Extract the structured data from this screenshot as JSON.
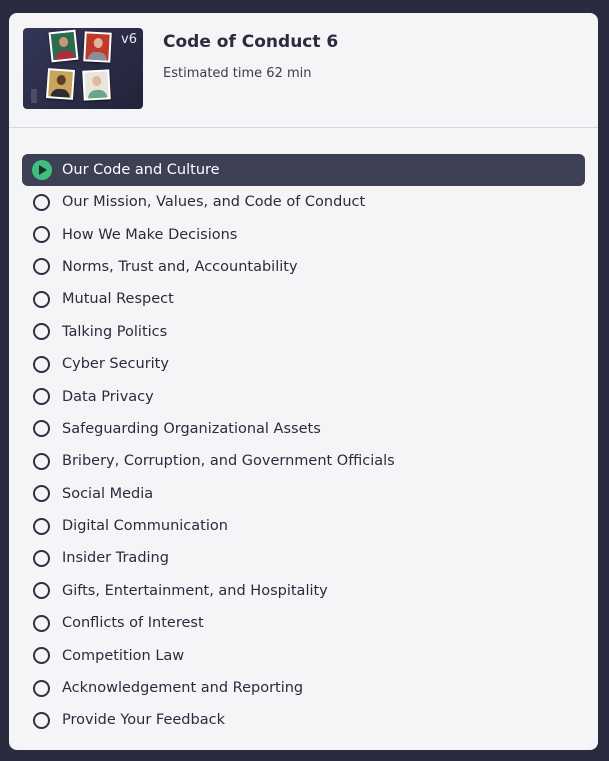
{
  "course": {
    "title": "Code of Conduct 6",
    "estimated_time": "Estimated time 62 min",
    "version_badge": "v6"
  },
  "colors": {
    "page_bg": "#2b2b40",
    "panel_bg": "#f5f5f7",
    "active_row_bg": "#3e4056",
    "play_icon": "#3fbf7f"
  },
  "lessons": [
    {
      "label": "Our Code and Culture",
      "state": "current",
      "icon": "play-icon"
    },
    {
      "label": "Our Mission, Values, and Code of Conduct",
      "state": "not-started",
      "icon": "empty-circle-icon"
    },
    {
      "label": "How We Make Decisions",
      "state": "not-started",
      "icon": "empty-circle-icon"
    },
    {
      "label": "Norms, Trust and, Accountability",
      "state": "not-started",
      "icon": "empty-circle-icon"
    },
    {
      "label": "Mutual Respect",
      "state": "not-started",
      "icon": "empty-circle-icon"
    },
    {
      "label": "Talking Politics",
      "state": "not-started",
      "icon": "empty-circle-icon"
    },
    {
      "label": "Cyber Security",
      "state": "not-started",
      "icon": "empty-circle-icon"
    },
    {
      "label": "Data Privacy",
      "state": "not-started",
      "icon": "empty-circle-icon"
    },
    {
      "label": "Safeguarding Organizational Assets",
      "state": "not-started",
      "icon": "empty-circle-icon"
    },
    {
      "label": "Bribery, Corruption, and Government Officials",
      "state": "not-started",
      "icon": "empty-circle-icon"
    },
    {
      "label": "Social Media",
      "state": "not-started",
      "icon": "empty-circle-icon"
    },
    {
      "label": "Digital Communication",
      "state": "not-started",
      "icon": "empty-circle-icon"
    },
    {
      "label": "Insider Trading",
      "state": "not-started",
      "icon": "empty-circle-icon"
    },
    {
      "label": "Gifts, Entertainment, and Hospitality",
      "state": "not-started",
      "icon": "empty-circle-icon"
    },
    {
      "label": "Conflicts of Interest",
      "state": "not-started",
      "icon": "empty-circle-icon"
    },
    {
      "label": "Competition Law",
      "state": "not-started",
      "icon": "empty-circle-icon"
    },
    {
      "label": "Acknowledgement and Reporting",
      "state": "not-started",
      "icon": "empty-circle-icon"
    },
    {
      "label": "Provide Your Feedback",
      "state": "not-started",
      "icon": "empty-circle-icon"
    }
  ]
}
